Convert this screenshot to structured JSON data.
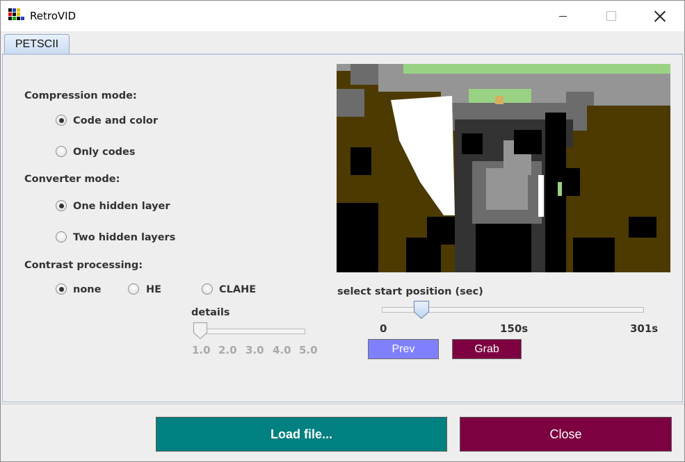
{
  "window": {
    "title": "RetroVID"
  },
  "tabs": [
    {
      "label": "PETSCII",
      "selected": true
    }
  ],
  "compression": {
    "heading": "Compression mode:",
    "options": [
      {
        "label": "Code and color",
        "selected": true
      },
      {
        "label": "Only codes",
        "selected": false
      }
    ]
  },
  "converter": {
    "heading": "Converter mode:",
    "options": [
      {
        "label": "One hidden layer",
        "selected": true
      },
      {
        "label": "Two hidden layers",
        "selected": false
      }
    ]
  },
  "contrast": {
    "heading": "Contrast processing:",
    "options": [
      {
        "label": "none",
        "selected": true
      },
      {
        "label": "HE",
        "selected": false
      },
      {
        "label": "CLAHE",
        "selected": false
      }
    ],
    "details": {
      "label": "details",
      "enabled": false,
      "value": 1.0,
      "ticks": [
        "1.0",
        "2.0",
        "3.0",
        "4.0",
        "5.0"
      ]
    }
  },
  "position": {
    "label": "select start position (sec)",
    "value_fraction": 0.15,
    "ticks": [
      "0",
      "150s",
      "301s"
    ]
  },
  "buttons": {
    "prev": "Prev",
    "grab": "Grab",
    "load": "Load file...",
    "close": "Close"
  },
  "colors": {
    "teal": "#008080",
    "wine": "#7d0040",
    "prev_blue": "#8080ff",
    "c64_brown": "#4d3a00",
    "c64_light_green": "#9ad284",
    "c64_gray": "#6c6c6c",
    "c64_light_gray": "#959595"
  }
}
